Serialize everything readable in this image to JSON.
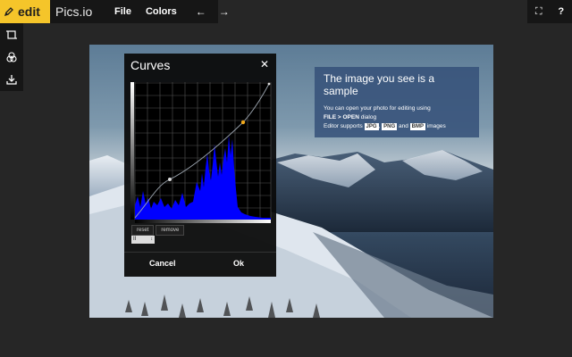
{
  "app": {
    "edit_label": "edit",
    "name": "Pics.io"
  },
  "menu": {
    "file_label": "File",
    "colors_label": "Colors",
    "undo_glyph": "←",
    "redo_glyph": "→"
  },
  "right_tools": {
    "fullscreen_glyph": "⛶",
    "help_glyph": "?"
  },
  "info_panel": {
    "title": "The image you see is a sample",
    "line1": "You can open your photo for editing using",
    "line2_prefix": "FILE > OPEN",
    "line2_suffix": " dialog",
    "line3_prefix": "Editor supports ",
    "format1": "JPG",
    "sep1": ", ",
    "format2": "PNG",
    "sep2": " and ",
    "format3": "BMP",
    "line3_suffix": " images"
  },
  "curves_dialog": {
    "title": "Curves",
    "close_glyph": "✕",
    "reset_label": "reset",
    "remove_label": "remove",
    "channel_value": "II",
    "cancel_label": "Cancel",
    "ok_label": "Ok",
    "curve_color": "#9aa3ad",
    "histogram_color": "#0000ff",
    "point_colors": [
      "#dddddd",
      "#f0a81a"
    ]
  },
  "colors": {
    "accent": "#f5c52a",
    "info_panel": "#37527a"
  }
}
